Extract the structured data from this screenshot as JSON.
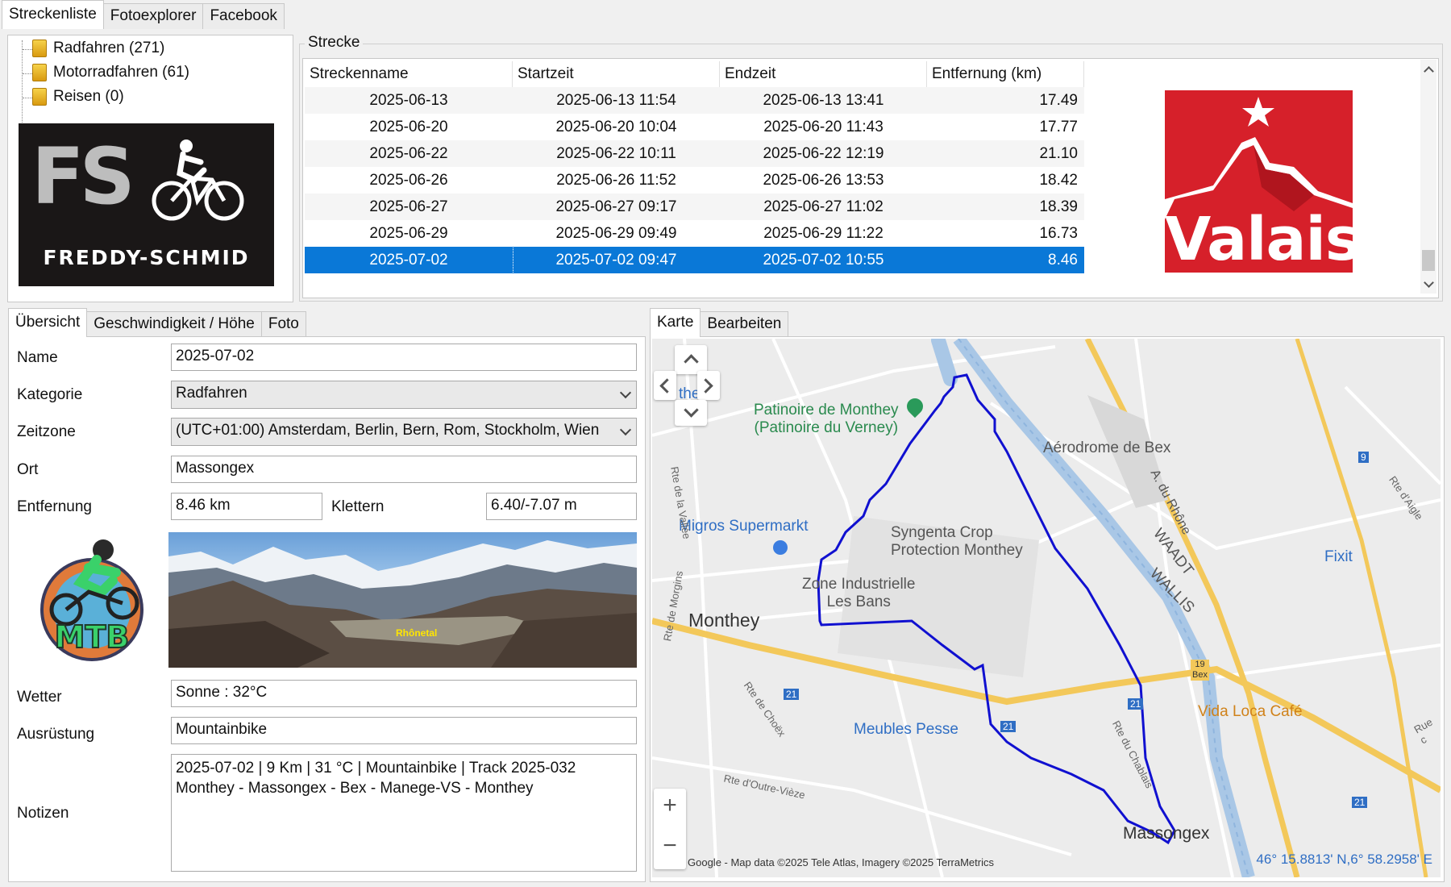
{
  "top_tabs": [
    "Streckenliste",
    "Fotoexplorer",
    "Facebook"
  ],
  "tree": [
    {
      "label": "Radfahren (271)"
    },
    {
      "label": "Motorradfahren (61)"
    },
    {
      "label": "Reisen (0)"
    }
  ],
  "logo_freddy": {
    "letters": "FS",
    "name": "FREDDY-SCHMID"
  },
  "strecke": {
    "group_label": "Strecke",
    "columns": [
      "Streckenname",
      "Startzeit",
      "Endzeit",
      "Entfernung (km)"
    ],
    "rows": [
      {
        "name": "2025-06-13",
        "start": "2025-06-13 11:54",
        "end": "2025-06-13 13:41",
        "dist": "17.49"
      },
      {
        "name": "2025-06-20",
        "start": "2025-06-20 10:04",
        "end": "2025-06-20 11:43",
        "dist": "17.77"
      },
      {
        "name": "2025-06-22",
        "start": "2025-06-22 10:11",
        "end": "2025-06-22 12:19",
        "dist": "21.10"
      },
      {
        "name": "2025-06-26",
        "start": "2025-06-26 11:52",
        "end": "2025-06-26 13:53",
        "dist": "18.42"
      },
      {
        "name": "2025-06-27",
        "start": "2025-06-27 09:17",
        "end": "2025-06-27 11:02",
        "dist": "18.39"
      },
      {
        "name": "2025-06-29",
        "start": "2025-06-29 09:49",
        "end": "2025-06-29 11:22",
        "dist": "16.73"
      },
      {
        "name": "2025-07-02",
        "start": "2025-07-02 09:47",
        "end": "2025-07-02 10:55",
        "dist": "8.46"
      }
    ],
    "selected_index": 6
  },
  "valais_logo": {
    "text": "Valais",
    "color": "#d6202a"
  },
  "detail_tabs": [
    "Übersicht",
    "Geschwindigkeit / Höhe",
    "Foto"
  ],
  "form": {
    "name_label": "Name",
    "name_value": "2025-07-02",
    "kategorie_label": "Kategorie",
    "kategorie_value": "Radfahren",
    "zeitzone_label": "Zeitzone",
    "zeitzone_value": "(UTC+01:00) Amsterdam, Berlin, Bern, Rom, Stockholm, Wien",
    "ort_label": "Ort",
    "ort_value": "Massongex",
    "entfernung_label": "Entfernung",
    "entfernung_value": "8.46 km",
    "klettern_label": "Klettern",
    "klettern_value": "6.40/-7.07 m",
    "wetter_label": "Wetter",
    "wetter_value": "Sonne  :  32°C",
    "ausruestung_label": "Ausrüstung",
    "ausruestung_value": "Mountainbike",
    "notizen_label": "Notizen",
    "notizen_value": "2025-07-02 | 9 Km | 31 °C | Mountainbike | Track 2025-032\nMonthey - Massongex - Bex - Manege-VS - Monthey"
  },
  "mtb_logo": {
    "text": "MTB"
  },
  "photo": {
    "caption": "Rhônetal"
  },
  "map_tabs": [
    "Karte",
    "Bearbeiten"
  ],
  "map": {
    "labels": {
      "patinoire": "Patinoire de Monthey\n(Patinoire du Verney)",
      "aerodrome": "Aérodrome de Bex",
      "migros": "Migros Supermarkt",
      "syngenta": "Syngenta Crop\nProtection Monthey",
      "zone": "Zone Industrielle\nLes Bans",
      "monthey": "Monthey",
      "they": "they",
      "fixit": "Fixit",
      "waadt": "WAADT",
      "wallis": "WALLIS",
      "adurhone": "A. du Rhône",
      "meubles": "Meubles Pesse",
      "vidaloca": "Vida Loca Café",
      "massongex": "Massongex",
      "rte_vallee": "Rte de la Vallée",
      "rte_morgins": "Rte de Morgins",
      "rte_choex": "Rte de Choëx",
      "rte_outre": "Rte d'Outre-Vièze",
      "rte_chablais": "Rte du Chablais",
      "rte_aigle": "Rte d'Aigle",
      "rte_e": "Rue c",
      "road_21": "21",
      "road_9": "9",
      "road_19": "19",
      "bex": "Bex"
    },
    "attribution": "Google - Map data ©2025 Tele Atlas, Imagery ©2025 TerraMetrics",
    "coordinates": "46° 15.8813' N,6° 58.2958' E",
    "zoom_in": "+",
    "zoom_out": "−",
    "route_color": "#1010d0"
  }
}
